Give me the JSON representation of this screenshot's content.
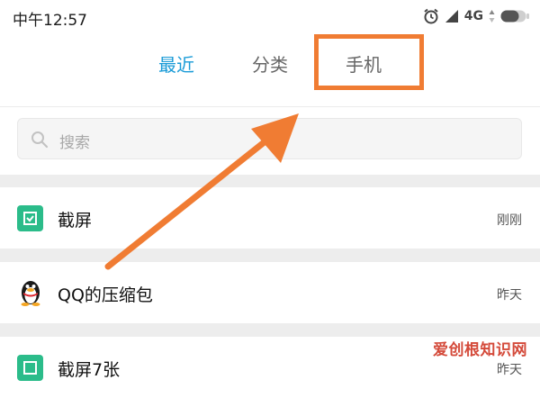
{
  "status_bar": {
    "time": "中午12:57",
    "network": "4G",
    "icons": [
      "alarm-icon",
      "signal-icon",
      "data-arrows-icon",
      "battery-icon"
    ]
  },
  "tabs": [
    {
      "label": "最近",
      "active": true
    },
    {
      "label": "分类",
      "active": false
    },
    {
      "label": "手机",
      "active": false
    }
  ],
  "search": {
    "placeholder": "搜索",
    "icon": "search-icon"
  },
  "files": [
    {
      "title": "截屏",
      "time": "刚刚",
      "icon": "screenshot-folder-icon"
    },
    {
      "title": "QQ的压缩包",
      "time": "昨天",
      "icon": "qq-penguin-icon"
    },
    {
      "title": "截屏7张",
      "time": "昨天",
      "icon": "screenshot-folder-icon"
    }
  ],
  "annotation": {
    "color": "#f07c33"
  },
  "colors": {
    "accent": "#1a9bd7",
    "folder_icon": "#2bbc8a"
  },
  "watermark": "爱创根知识网"
}
